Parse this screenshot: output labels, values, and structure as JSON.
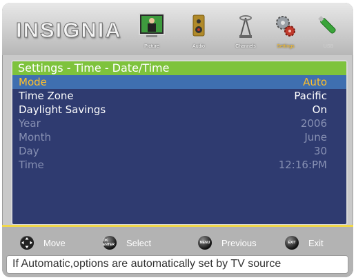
{
  "header": {
    "logo": "INSIGNIA",
    "tabs": [
      {
        "label": "Picture",
        "icon": "picture-icon",
        "state": "normal"
      },
      {
        "label": "Audio",
        "icon": "audio-speaker-icon",
        "state": "normal"
      },
      {
        "label": "Channels",
        "icon": "antenna-icon",
        "state": "normal"
      },
      {
        "label": "Settings",
        "icon": "settings-gears-icon",
        "state": "selected"
      },
      {
        "label": "USB",
        "icon": "usb-stick-icon",
        "state": "dim"
      }
    ]
  },
  "panel": {
    "title": "Settings - Time - Date/Time",
    "rows": [
      {
        "label": "Mode",
        "value": "Auto",
        "state": "active"
      },
      {
        "label": "Time Zone",
        "value": "Pacific",
        "state": "enabled"
      },
      {
        "label": "Daylight Savings",
        "value": "On",
        "state": "enabled"
      },
      {
        "label": "Year",
        "value": "2006",
        "state": "disabled"
      },
      {
        "label": "Month",
        "value": "June",
        "state": "disabled"
      },
      {
        "label": "Day",
        "value": "30",
        "state": "disabled"
      },
      {
        "label": "Time",
        "value": "12:16:PM",
        "state": "disabled"
      }
    ]
  },
  "footer": {
    "help": [
      {
        "icon_text": "",
        "label": "Move"
      },
      {
        "icon_text": "OK ENTER",
        "label": "Select"
      },
      {
        "icon_text": "MENU",
        "label": "Previous"
      },
      {
        "icon_text": "EXIT",
        "label": "Exit"
      }
    ],
    "description": "If Automatic,options are automatically set by TV source"
  },
  "colors": {
    "panel_bg": "#2f3b70",
    "title_bar": "#7ec33c",
    "active_row_bg": "#3f6fb0",
    "active_text": "#ffbf2a",
    "disabled_text": "#8790b3",
    "footer_accent": "#f1d84a"
  }
}
